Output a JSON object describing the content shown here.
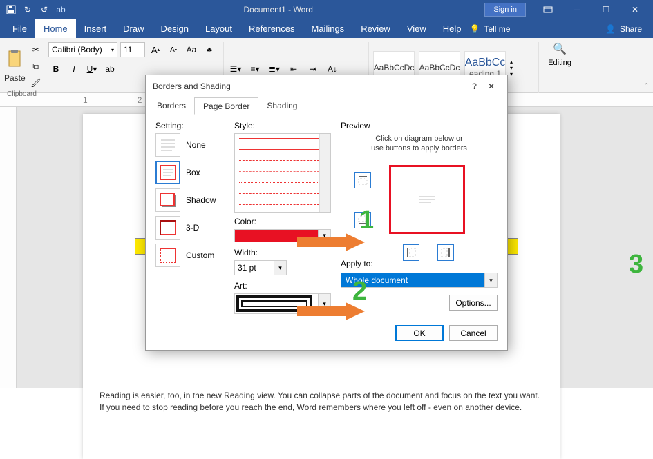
{
  "titlebar": {
    "title": "Document1 - Word",
    "sign_in": "Sign in"
  },
  "menu": {
    "file": "File",
    "home": "Home",
    "insert": "Insert",
    "draw": "Draw",
    "design": "Design",
    "layout": "Layout",
    "references": "References",
    "mailings": "Mailings",
    "review": "Review",
    "view": "View",
    "help": "Help",
    "tellme": "Tell me",
    "share": "Share"
  },
  "ribbon": {
    "clipboard": "Clipboard",
    "paste": "Paste",
    "font_name": "Calibri (Body)",
    "font_size": "11",
    "styles": {
      "s1": "AaBbCcDc",
      "s2": "AaBbCcDc",
      "s3": "AaBbCc",
      "heading1": "eading 1"
    },
    "editing": "Editing"
  },
  "dialog": {
    "title": "Borders and Shading",
    "tabs": {
      "borders": "Borders",
      "page_border": "Page Border",
      "shading": "Shading"
    },
    "setting_label": "Setting:",
    "settings": {
      "none": "None",
      "box": "Box",
      "shadow": "Shadow",
      "threed": "3-D",
      "custom": "Custom"
    },
    "style_label": "Style:",
    "color_label": "Color:",
    "width_label": "Width:",
    "width_value": "31 pt",
    "art_label": "Art:",
    "preview_label": "Preview",
    "preview_text1": "Click on diagram below or",
    "preview_text2": "use buttons to apply borders",
    "apply_label": "Apply to:",
    "apply_value": "Whole document",
    "options": "Options...",
    "ok": "OK",
    "cancel": "Cancel",
    "help": "?"
  },
  "doc": {
    "para": "Reading is easier, too, in the new Reading view. You can collapse parts of the document and focus on the text you want. If you need to stop reading before you reach the end, Word remembers where you left off - even on another device."
  },
  "anno": {
    "n1": "1",
    "n2": "2",
    "n3": "3"
  }
}
